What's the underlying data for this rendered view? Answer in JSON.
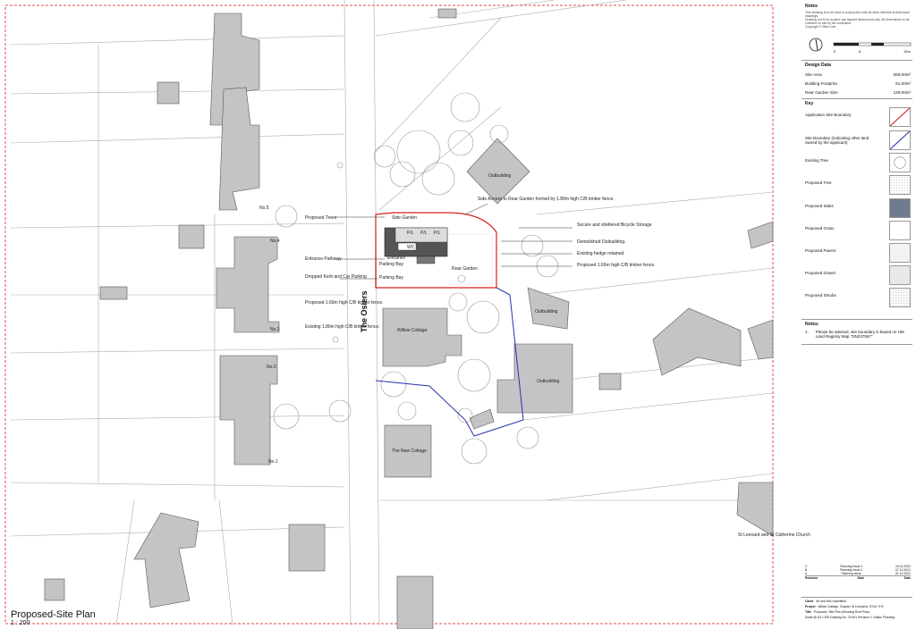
{
  "road": "The Osiers",
  "plan": {
    "title": "Proposed-Site Plan",
    "scale": "1 : 200"
  },
  "labels": {
    "no3": "No.3",
    "no4": "No.4",
    "no5": "No.5",
    "no2": "No.2",
    "no1": "No.1",
    "outbuilding": "Outbuilding",
    "willow_cottage": "Willow Cottage",
    "new_cottage": "The New Cottage",
    "church": "St Leonard and St Catherine Church",
    "side_garden": "Side Garden",
    "rear_garden": "Rear Garden",
    "entrance": "Entrance",
    "parking_bay": "Parking Bay",
    "pv": "P/L",
    "wc": "WC",
    "proposed_trees": "Proposed Trees",
    "entrance_pathway": "Entrance Pathway",
    "dropped_kerb": "Dropped Kerb and Car Parking",
    "proposed_fence_left": "Proposed 1.60m high C/B timber fence.",
    "existing_fence_left": "Existing 1.80m high C/B timber fence.",
    "side_access": "Side Access to Rear Garden formed by 1.80m high C/B timber fence.",
    "bicycle": "Secure and sheltered Bicycle Storage",
    "demolished": "Demolished Outbuilding.",
    "hedge": "Existing hedge retained.",
    "proposed_fence_right": "Proposed 1.60m high C/B timber fence."
  },
  "sidebar": {
    "notes_header": "Notes",
    "notes_lines": [
      "This drawing is to be read in conjunction with all other relevant architectural drawings.",
      "Drawing not to be scaled; use figured dimensions only. All dimensions to be checked on site by the contractor.",
      "Copyright © Miss Carr"
    ],
    "scale_bar": [
      "0",
      "6",
      "12m"
    ],
    "design_data_title": "Design Data",
    "design_data": [
      {
        "label": "Site Area",
        "value": "266.00m²"
      },
      {
        "label": "Building Footprint",
        "value": "61.00m²"
      },
      {
        "label": "Rear Garden Size",
        "value": "130.00m²"
      }
    ],
    "key_title": "Key",
    "key": [
      {
        "label": "Application Site Boundary",
        "kind": "red-line"
      },
      {
        "label": "Site Boundary (indicating other land owned by the applicant)",
        "kind": "blue-line"
      },
      {
        "label": "Existing Tree",
        "kind": "circle"
      },
      {
        "label": "Proposed Tree",
        "kind": "dots"
      },
      {
        "label": "Proposed Slabs",
        "kind": "slate"
      },
      {
        "label": "Proposed Grass",
        "kind": "white"
      },
      {
        "label": "Proposed Pavers",
        "kind": "light"
      },
      {
        "label": "Proposed Gravel",
        "kind": "gravel"
      },
      {
        "label": "Proposed Shrubs",
        "kind": "grid"
      }
    ],
    "notes_title": "Notes:",
    "note_1_num": "1.",
    "note_1": "Please be advised, site boundary is based on HM Land Registry Map \"DN237567\"",
    "revisions": [
      {
        "rev": "C",
        "desc": "Planning Issue 3",
        "date": "15.01.2022"
      },
      {
        "rev": "B",
        "desc": "Planning Issue 2",
        "date": "07.12.2021"
      },
      {
        "rev": "A",
        "desc": "Planning Issue",
        "date": "01.12.2021"
      }
    ],
    "rev_headers": [
      "Revision",
      "Note",
      "Date"
    ],
    "client_label": "Client",
    "client": "Mr and Mrs Ussellfield",
    "project_label": "Project",
    "project": "Willow Cottage, Chapter St Leonards, EX16 7HY",
    "title_label": "Title",
    "title": "Proposed- Site Plan (Showing Roof Plan)",
    "footer": "Scale @ A3 1:200  Drawing No. 21/001  Revision C  Status Planning"
  },
  "colors": {
    "red_boundary": "#d62020",
    "blue_boundary": "#2433b0",
    "building": "#c4c4c4",
    "slabs": "#6f7c8e"
  }
}
